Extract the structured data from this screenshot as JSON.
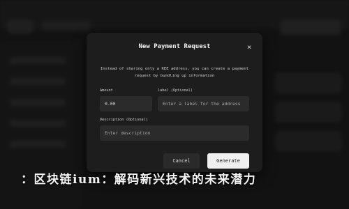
{
  "modal": {
    "title": "New Payment Request",
    "close_icon": "×",
    "description": "Instead of sharing only a KEE address, you can create a payment request by bundling up information",
    "amount_label": "Amount",
    "amount_value": "0.00",
    "label_label": "label (Optional)",
    "label_placeholder": "Enter a label for the address",
    "description_label": "Description (Optional)",
    "description_placeholder": "Enter description",
    "cancel_label": "Cancel",
    "generate_label": "Generate"
  },
  "headline": "：区块链ium：解码新兴技术的未来潜力"
}
